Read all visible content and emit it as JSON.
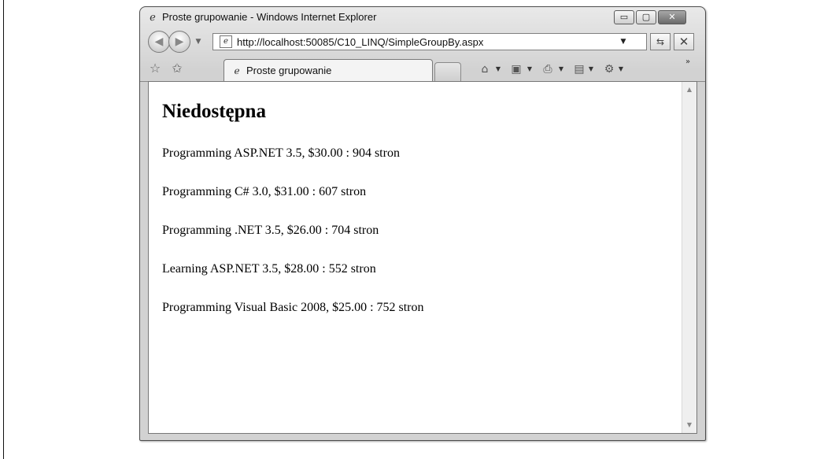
{
  "window": {
    "title": "Proste grupowanie - Windows Internet Explorer",
    "controls": {
      "minimize": "▭",
      "maximize": "▢",
      "close": "✕"
    }
  },
  "icons": {
    "ie": "ℯ",
    "back": "◀",
    "forward": "▶",
    "dropdown": "▼",
    "refresh": "⇆",
    "stop": "✕",
    "star": "☆",
    "add_favorite": "✩",
    "home": "⌂",
    "feeds": "▣",
    "print": "⎙",
    "page": "▤",
    "tools": "⚙",
    "more": "»",
    "scroll_up": "▲",
    "scroll_down": "▼"
  },
  "navigation": {
    "url": "http://localhost:50085/C10_LINQ/SimpleGroupBy.aspx"
  },
  "tabs": [
    {
      "label": "Proste grupowanie"
    }
  ],
  "page": {
    "heading": "Niedostępna",
    "books": [
      "Programming ASP.NET 3.5, $30.00 : 904 stron",
      "Programming C# 3.0, $31.00 : 607 stron",
      "Programming .NET 3.5, $26.00 : 704 stron",
      "Learning ASP.NET 3.5, $28.00 : 552 stron",
      "Programming Visual Basic 2008, $25.00 : 752 stron"
    ]
  }
}
